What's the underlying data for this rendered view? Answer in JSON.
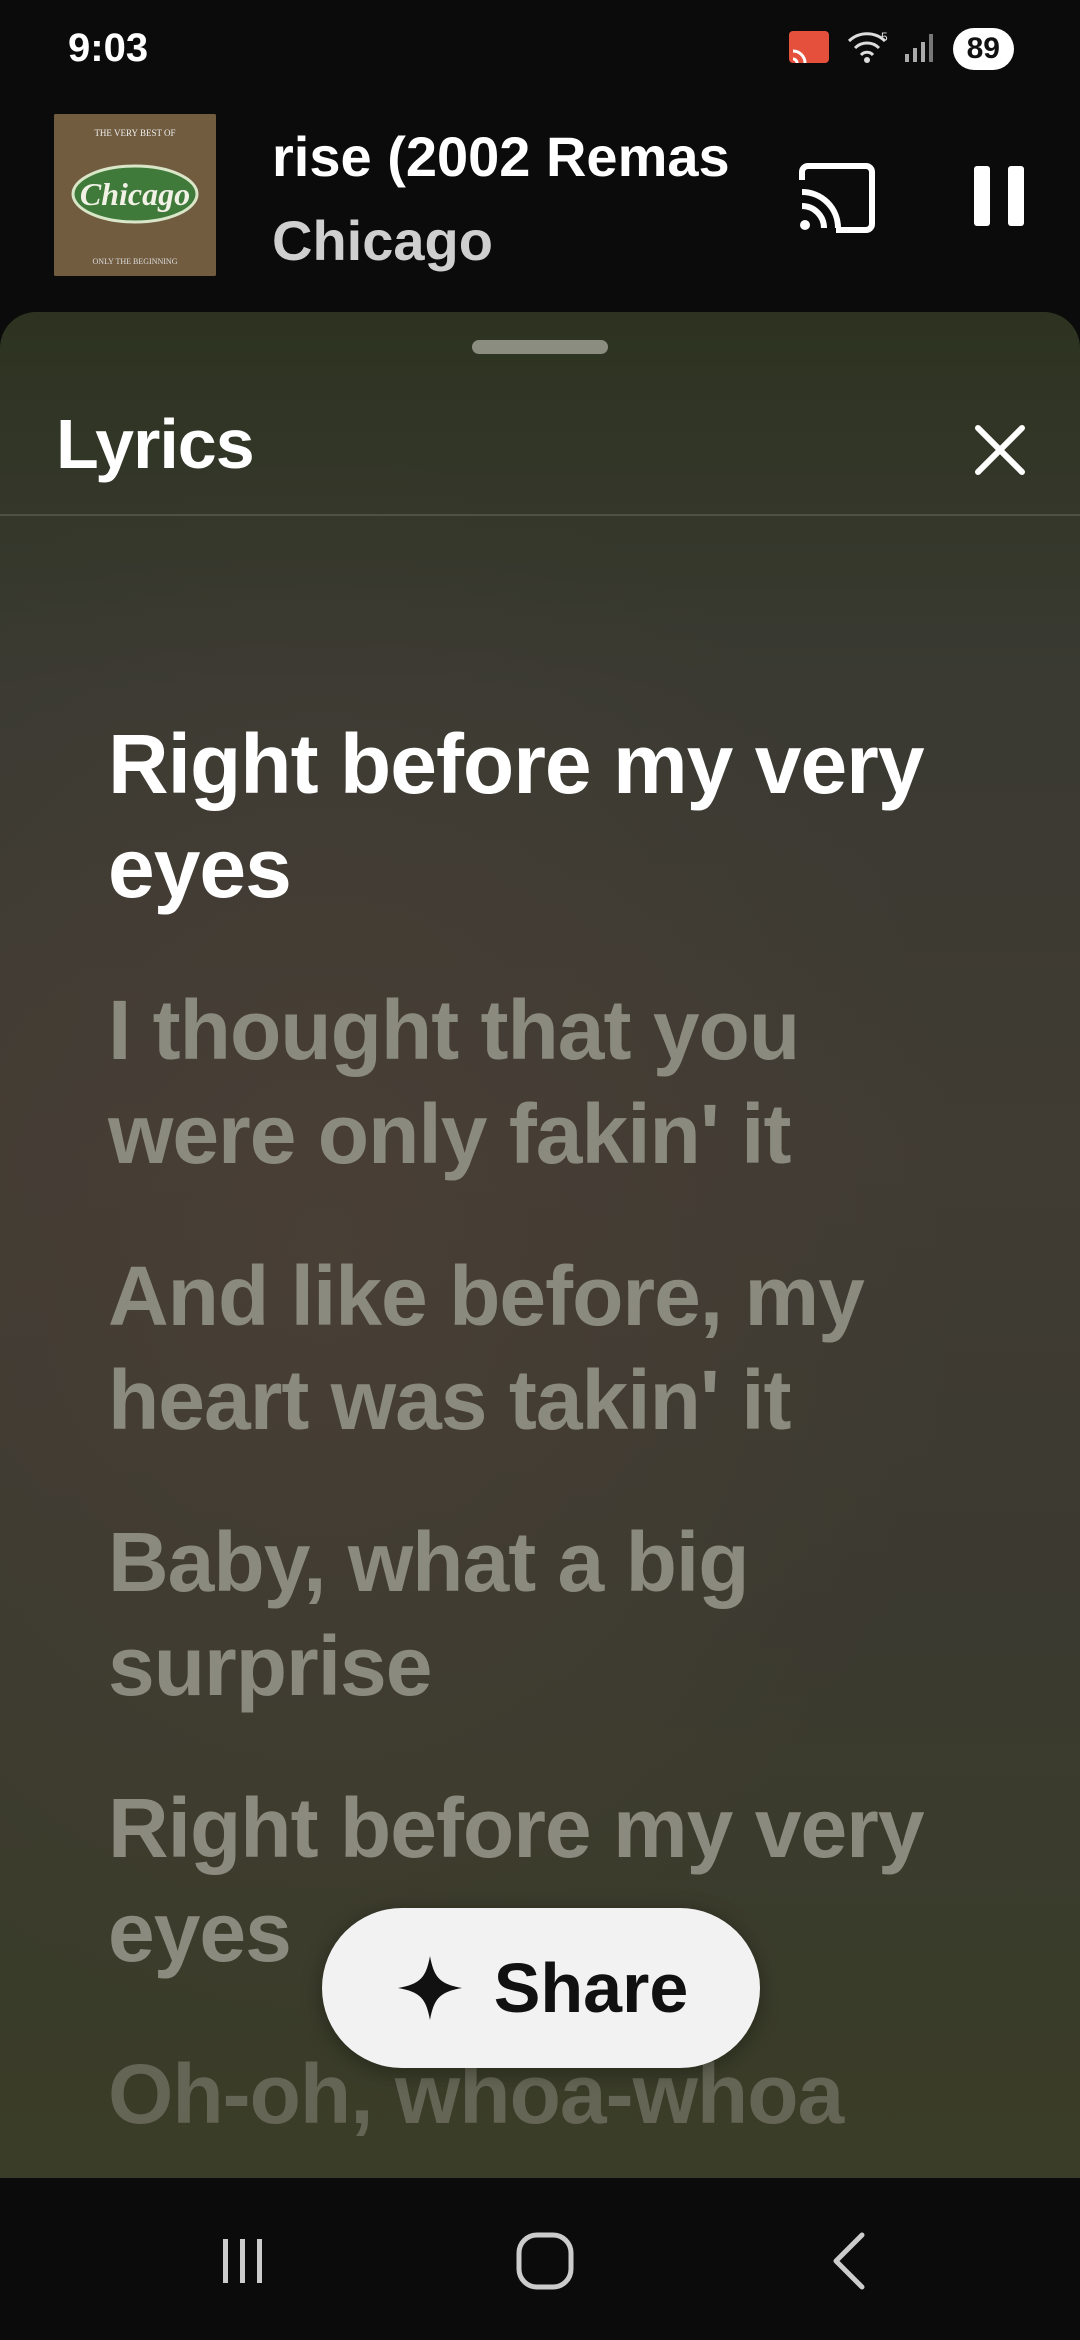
{
  "status": {
    "time": "9:03",
    "battery": "89",
    "network": "5"
  },
  "player": {
    "album": {
      "header": "THE VERY BEST OF",
      "logo": "Chicago",
      "subtitle": "ONLY THE BEGINNING"
    },
    "title": "rise (2002 Remas",
    "artist": "Chicago"
  },
  "lyrics_sheet": {
    "title": "Lyrics",
    "lines": [
      "Right before my very eyes",
      "I thought that you were only fakin' it",
      "And like before, my heart was takin' it",
      "Baby, what a big surprise",
      "Right before my very eyes",
      "Oh-oh, whoa-whoa"
    ],
    "active_index": 0,
    "share_label": "Share"
  },
  "colors": {
    "accent": "#ffffff",
    "inactive_lyric": "#8b8a7e"
  }
}
